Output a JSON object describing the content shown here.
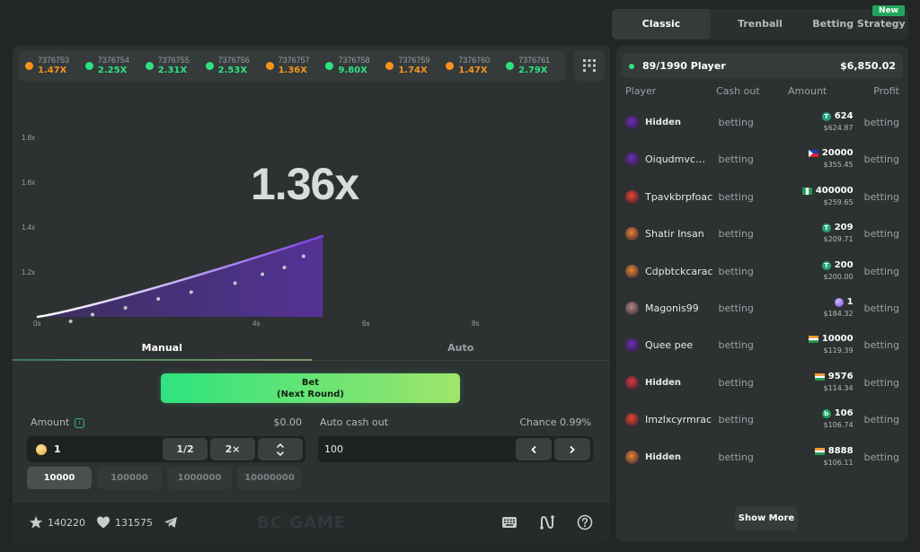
{
  "history": [
    {
      "id": "7376753",
      "mult": "1.47X",
      "color": "#f7931a"
    },
    {
      "id": "7376754",
      "mult": "2.25X",
      "color": "#2ee37e"
    },
    {
      "id": "7376755",
      "mult": "2.31X",
      "color": "#2ee37e"
    },
    {
      "id": "7376756",
      "mult": "2.53X",
      "color": "#2ee37e"
    },
    {
      "id": "7376757",
      "mult": "1.36X",
      "color": "#f7931a"
    },
    {
      "id": "7376758",
      "mult": "9.80X",
      "color": "#2ee37e"
    },
    {
      "id": "7376759",
      "mult": "1.74X",
      "color": "#f7931a"
    },
    {
      "id": "7376760",
      "mult": "1.47X",
      "color": "#f7931a"
    },
    {
      "id": "7376761",
      "mult": "2.79X",
      "color": "#2ee37e"
    }
  ],
  "history_grid_icon": "grid-icon",
  "game": {
    "current_multiplier": "1.36x",
    "y_ticks": [
      "1.2x",
      "1.4x",
      "1.6x",
      "1.8x"
    ],
    "x_ticks": [
      "0s",
      "4s",
      "6s",
      "8s"
    ],
    "curve": {
      "elapsed_seconds": 5.2,
      "current_value": 1.36
    }
  },
  "mode_tabs": [
    {
      "label": "Manual",
      "active": true
    },
    {
      "label": "Auto",
      "active": false
    }
  ],
  "bet_button": {
    "line1": "Bet",
    "line2": "(Next Round)"
  },
  "amount": {
    "label": "Amount",
    "usd_value": "$0.00",
    "value": "1",
    "half_label": "1/2",
    "double_label": "2×",
    "chips": [
      {
        "label": "10000",
        "active": true
      },
      {
        "label": "100000",
        "active": false
      },
      {
        "label": "1000000",
        "active": false
      },
      {
        "label": "10000000",
        "active": false
      }
    ]
  },
  "auto_cash_out": {
    "label": "Auto cash out",
    "chance": "Chance 0.99%",
    "value": "100"
  },
  "footer": {
    "favorites": "140220",
    "likes": "131575",
    "brand": "BC GAME"
  },
  "right_tabs": [
    {
      "label": "Classic",
      "active": true
    },
    {
      "label": "Trenball",
      "active": false
    },
    {
      "label": "Betting Strategy",
      "active": false,
      "badge": "New"
    }
  ],
  "players_summary": {
    "count": "89/1990 Player",
    "total": "$6,850.02"
  },
  "table_headers": [
    "Player",
    "Cash out",
    "Amount",
    "Profit"
  ],
  "players": [
    {
      "name": "Hidden",
      "hidden": true,
      "cashout": "betting",
      "amount": "624",
      "usd": "$624.87",
      "currency": "usdt",
      "profit": "betting",
      "avatar": "#6b2fb3"
    },
    {
      "name": "Oiqudmvcm...",
      "hidden": false,
      "cashout": "betting",
      "amount": "20000",
      "usd": "$355.45",
      "currency": "php",
      "profit": "betting",
      "avatar": "#6b2fb3"
    },
    {
      "name": "Tpavkbrpfoac",
      "hidden": false,
      "cashout": "betting",
      "amount": "400000",
      "usd": "$259.65",
      "currency": "ngn",
      "profit": "betting",
      "avatar": "#e8452f"
    },
    {
      "name": "Shatir Insan",
      "hidden": false,
      "cashout": "betting",
      "amount": "209",
      "usd": "$209.71",
      "currency": "usdt",
      "profit": "betting",
      "avatar": "#e8862f"
    },
    {
      "name": "Cdpbtckcarac",
      "hidden": false,
      "cashout": "betting",
      "amount": "200",
      "usd": "$200.00",
      "currency": "usdt",
      "profit": "betting",
      "avatar": "#e8862f"
    },
    {
      "name": "Magonis99",
      "hidden": false,
      "cashout": "betting",
      "amount": "1",
      "usd": "$184.32",
      "currency": "sol",
      "profit": "betting",
      "avatar": "#b08a7a"
    },
    {
      "name": "Quee pee",
      "hidden": false,
      "cashout": "betting",
      "amount": "10000",
      "usd": "$119.39",
      "currency": "inr",
      "profit": "betting",
      "avatar": "#6b2fb3"
    },
    {
      "name": "Hidden",
      "hidden": true,
      "cashout": "betting",
      "amount": "9576",
      "usd": "$114.34",
      "currency": "inr",
      "profit": "betting",
      "avatar": "#d83a3a"
    },
    {
      "name": "Imzlxcyrmrac",
      "hidden": false,
      "cashout": "betting",
      "amount": "106",
      "usd": "$106.74",
      "currency": "bcd",
      "profit": "betting",
      "avatar": "#e8452f"
    },
    {
      "name": "Hidden",
      "hidden": true,
      "cashout": "betting",
      "amount": "8888",
      "usd": "$106.11",
      "currency": "inr",
      "profit": "betting",
      "avatar": "#e8862f"
    }
  ],
  "show_more": "Show More"
}
